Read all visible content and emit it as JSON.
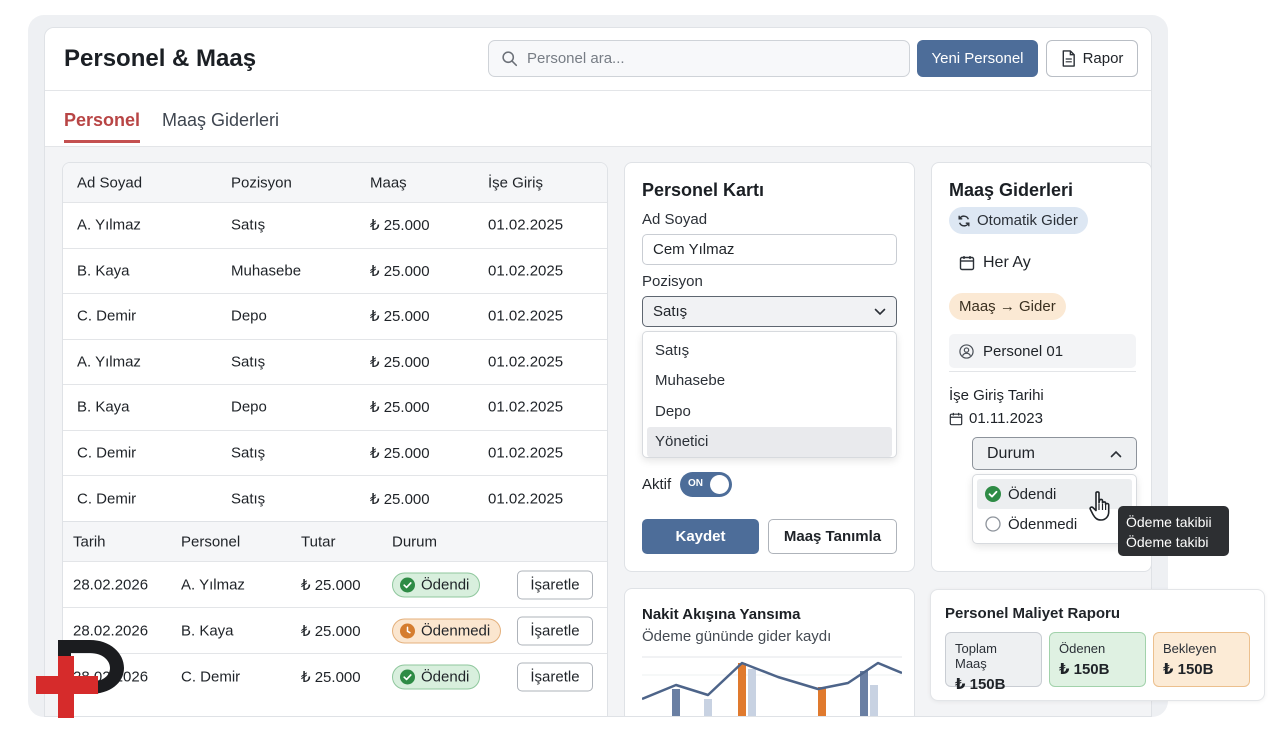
{
  "header": {
    "title": "Personel & Maaş",
    "search_placeholder": "Personel ara...",
    "new_employee_label": "Yeni Personel",
    "report_label": "Rapor"
  },
  "tabs": [
    {
      "label": "Personel",
      "active": true
    },
    {
      "label": "Maaş Giderleri",
      "active": false
    }
  ],
  "employee_table": {
    "columns": [
      "Ad Soyad",
      "Pozisyon",
      "Maaş",
      "İşe Giriş"
    ],
    "rows": [
      [
        "A. Yılmaz",
        "Satış",
        "₺ 25.000",
        "01.02.2025"
      ],
      [
        "B. Kaya",
        "Muhasebe",
        "₺ 25.000",
        "01.02.2025"
      ],
      [
        "C. Demir",
        "Depo",
        "₺ 25.000",
        "01.02.2025"
      ],
      [
        "A. Yılmaz",
        "Satış",
        "₺ 25.000",
        "01.02.2025"
      ],
      [
        "B. Kaya",
        "Depo",
        "₺ 25.000",
        "01.02.2025"
      ],
      [
        "C. Demir",
        "Satış",
        "₺ 25.000",
        "01.02.2025"
      ],
      [
        "C. Demir",
        "Satış",
        "₺ 25.000",
        "01.02.2025"
      ]
    ]
  },
  "payment_table": {
    "columns": [
      "Tarih",
      "Personel",
      "Tutar",
      "Durum"
    ],
    "rows": [
      {
        "date": "28.02.2026",
        "name": "A. Yılmaz",
        "amount": "₺ 25.000",
        "status": "Ödendi",
        "paid": true,
        "action": "İşaretle"
      },
      {
        "date": "28.02.2026",
        "name": "B. Kaya",
        "amount": "₺ 25.000",
        "status": "Ödenmedi",
        "paid": false,
        "action": "İşaretle"
      },
      {
        "date": "28.02.2026",
        "name": "C. Demir",
        "amount": "₺ 25.000",
        "status": "Ödendi",
        "paid": true,
        "action": "İşaretle"
      }
    ]
  },
  "employee_card": {
    "title": "Personel Kartı",
    "name_label": "Ad Soyad",
    "name_value": "Cem Yılmaz",
    "position_label": "Pozisyon",
    "position_value": "Satış",
    "position_options": [
      "Satış",
      "Muhasebe",
      "Depo",
      "Yönetici"
    ],
    "active_label": "Aktif",
    "toggle_text": "ON",
    "save_label": "Kaydet",
    "salary_def_label": "Maaş Tanımla"
  },
  "cash_flow": {
    "title": "Nakit Akışına Yansıma",
    "subtitle": "Ödeme gününde gider kaydı"
  },
  "salary_expenses": {
    "title": "Maaş Giderleri",
    "auto_label": "Otomatik Gider",
    "frequency": "Her Ay",
    "flow_label": "Maaş → Gider",
    "employee": "Personel 01",
    "start_label": "İşe Giriş Tarihi",
    "start_date": "01.11.2023",
    "status_label": "Durum",
    "status_options": [
      "Ödendi",
      "Ödenmedi"
    ]
  },
  "tooltip": {
    "line1": "Ödeme takibii",
    "line2": "Ödeme takibi"
  },
  "cost_report": {
    "title": "Personel Maliyet Raporu",
    "kpis": [
      {
        "label": "Toplam Maaş",
        "value": "₺ 150B"
      },
      {
        "label": "Ödenen",
        "value": "₺ 150B"
      },
      {
        "label": "Bekleyen",
        "value": "₺ 150B"
      }
    ]
  },
  "colors": {
    "primary": "#4d6d99",
    "tab_active": "#c45050",
    "paid": "#2e8b45",
    "unpaid": "#d57d2f",
    "logo_red": "#d62b2b"
  }
}
